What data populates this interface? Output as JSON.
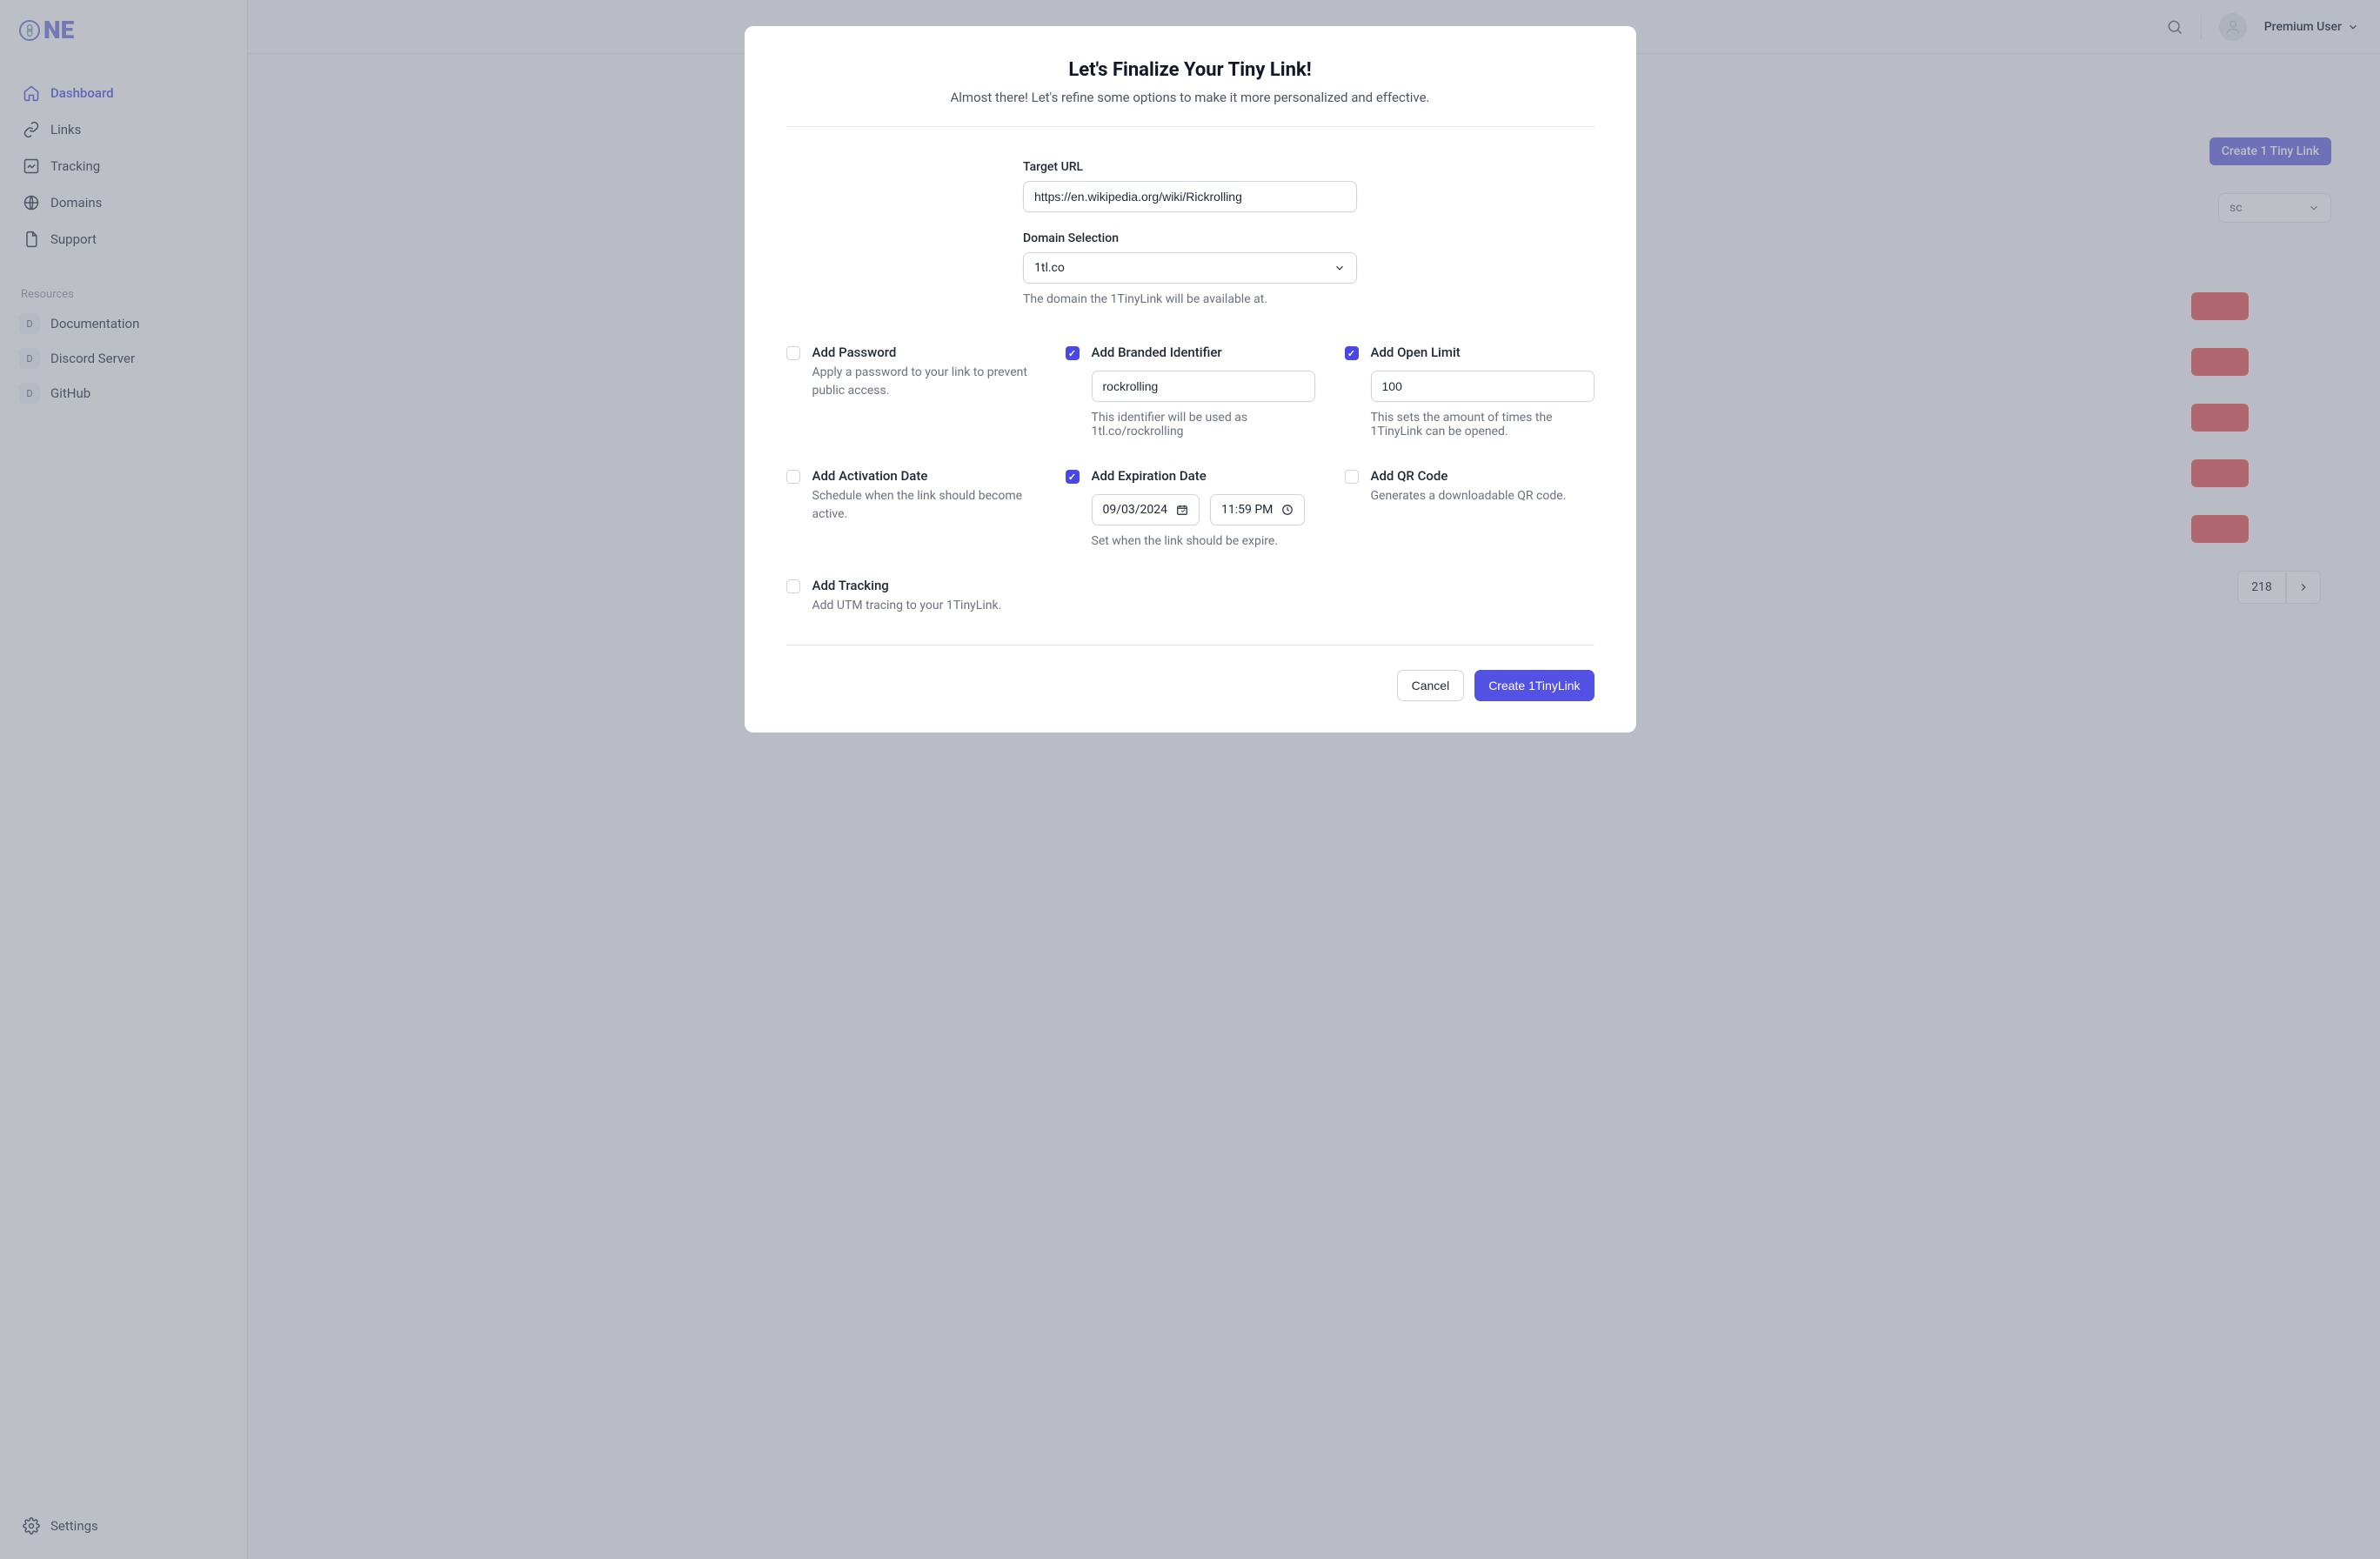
{
  "logo_text": "NE",
  "sidebar": {
    "nav": [
      {
        "label": "Dashboard"
      },
      {
        "label": "Links"
      },
      {
        "label": "Tracking"
      },
      {
        "label": "Domains"
      },
      {
        "label": "Support"
      }
    ],
    "resources_label": "Resources",
    "resources": [
      {
        "label": "Documentation"
      },
      {
        "label": "Discord Server"
      },
      {
        "label": "GitHub"
      }
    ],
    "settings_label": "Settings"
  },
  "topbar": {
    "user_label": "Premium User"
  },
  "background": {
    "create_btn": "Create 1 Tiny Link",
    "sort": "sc",
    "page_218": "218"
  },
  "modal": {
    "title": "Let's Finalize Your Tiny Link!",
    "subtitle": "Almost there! Let's refine some options to make it more personalized and effective.",
    "target_url_label": "Target URL",
    "target_url_value": "https://en.wikipedia.org/wiki/Rickrolling",
    "domain_label": "Domain Selection",
    "domain_value": "1tl.co",
    "domain_help": "The domain the 1TinyLink will be available at.",
    "options": {
      "password": {
        "title": "Add Password",
        "desc": "Apply a password to your link to prevent public access."
      },
      "branded": {
        "title": "Add Branded Identifier",
        "value": "rockrolling",
        "help": "This identifier will be used as 1tl.co/rockrolling"
      },
      "open_limit": {
        "title": "Add Open Limit",
        "value": "100",
        "help": "This sets the amount of times the 1TinyLink can be opened."
      },
      "activation": {
        "title": "Add Activation Date",
        "desc": "Schedule when the link should become active."
      },
      "expiration": {
        "title": "Add Expiration Date",
        "date": "09/03/2024",
        "time": "11:59 PM",
        "help": "Set when the link should be expire."
      },
      "qr": {
        "title": "Add QR Code",
        "desc": "Generates a downloadable QR code."
      },
      "tracking": {
        "title": "Add Tracking",
        "desc": "Add UTM tracing to your 1TinyLink."
      }
    },
    "footer": {
      "cancel": "Cancel",
      "create": "Create 1TinyLink"
    }
  }
}
